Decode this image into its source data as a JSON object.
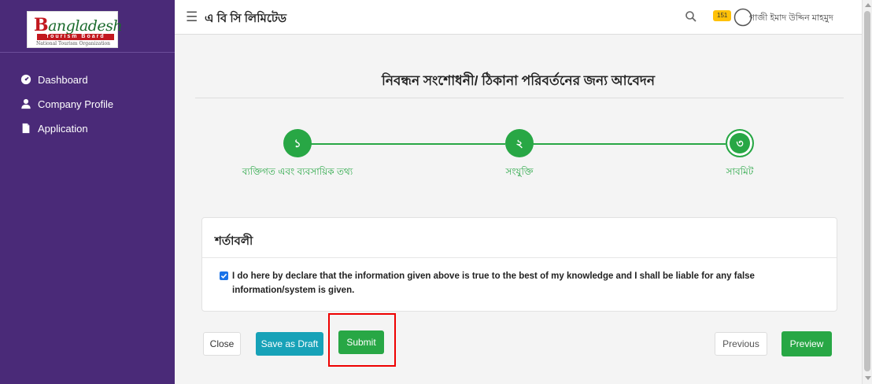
{
  "sidebar": {
    "logo": {
      "first_letter": "B",
      "name_rest": "angladesh",
      "strip": "Tourism Board",
      "sub": "National Tourism Organization"
    },
    "items": [
      {
        "label": "Dashboard",
        "icon": "tachometer-icon"
      },
      {
        "label": "Company Profile",
        "icon": "user-icon"
      },
      {
        "label": "Application",
        "icon": "file-icon"
      }
    ]
  },
  "header": {
    "menu_icon": "☰",
    "title": "এ বি সি লিমিটেড",
    "notification_count": "151",
    "user_name": "গাজী ইমাদ উদ্দিন মাহমুদ"
  },
  "page": {
    "title": "নিবন্ধন সংশোধনী/ ঠিকানা পরিবর্তনের জন্য আবেদন"
  },
  "steps": [
    {
      "number": "১",
      "label": "ব্যক্তিগত এবং ব্যবসায়িক তথ্য"
    },
    {
      "number": "২",
      "label": "সংযুক্তি"
    },
    {
      "number": "৩",
      "label": "সাবমিট"
    }
  ],
  "terms": {
    "heading": "শর্তাবলী",
    "checked": true,
    "declaration": "I do here by declare that the information given above is true to the best of my knowledge and I shall be liable for any false information/system is given."
  },
  "actions": {
    "close": "Close",
    "save_draft": "Save as Draft",
    "submit": "Submit",
    "previous": "Previous",
    "preview": "Preview"
  },
  "colors": {
    "sidebar": "#4a2a78",
    "success": "#28a745",
    "info": "#17a2b8",
    "highlight": "#ee0000",
    "badge": "#ffc107"
  }
}
